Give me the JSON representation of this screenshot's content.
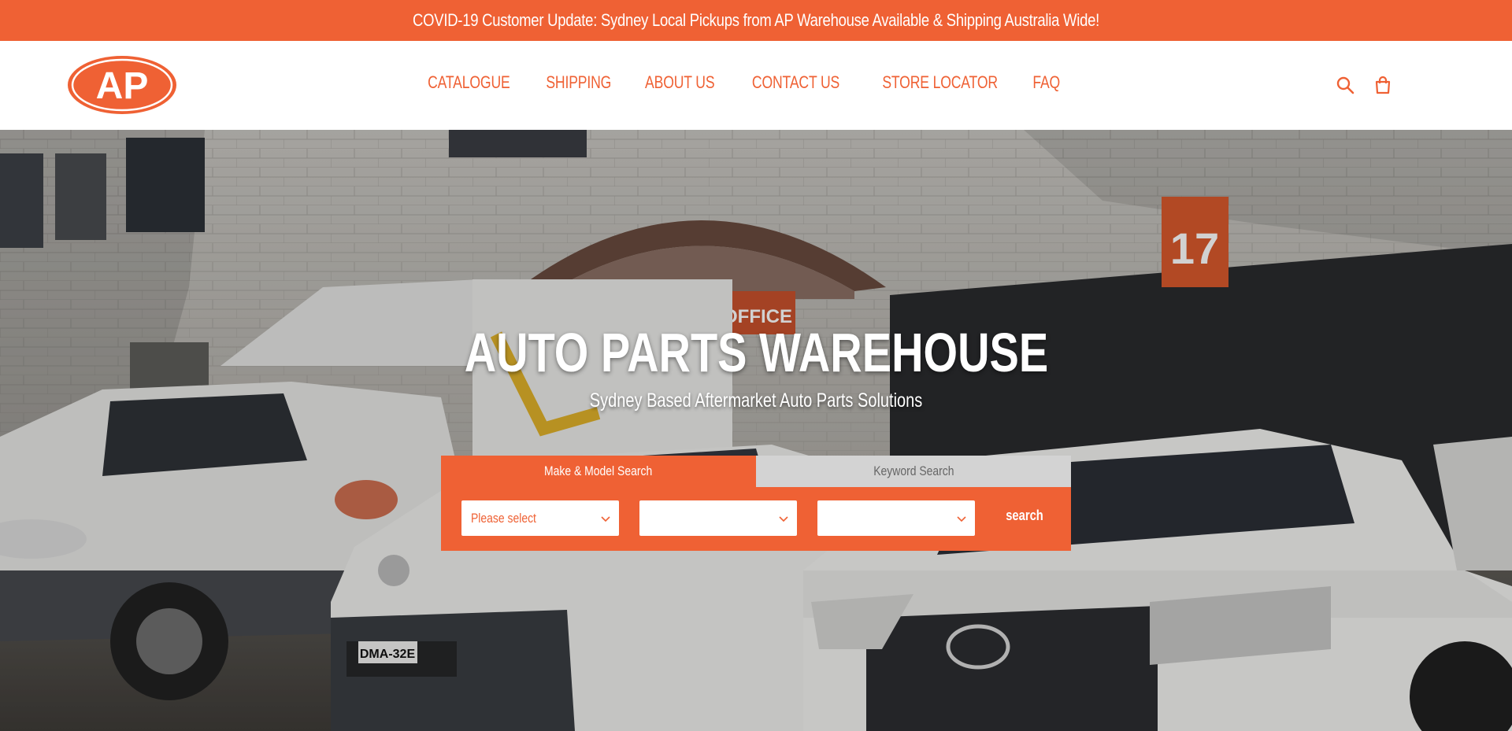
{
  "announcement": {
    "text": "COVID-19 Customer Update: Sydney Local Pickups from AP Warehouse Available & Shipping Australia Wide!"
  },
  "header": {
    "logo_text": "AP",
    "nav": [
      {
        "label": "CATALOGUE"
      },
      {
        "label": "SHIPPING"
      },
      {
        "label": "ABOUT US"
      },
      {
        "label": "CONTACT US"
      },
      {
        "label": "STORE LOCATOR"
      },
      {
        "label": "FAQ"
      }
    ],
    "icons": [
      "search-icon",
      "cart-icon"
    ]
  },
  "hero": {
    "title": "AUTO PARTS WAREHOUSE",
    "subtitle": "Sydney Based Aftermarket Auto Parts Solutions",
    "image_text": {
      "sign": "OFFICE",
      "unit_number": "17",
      "plate": "DMA-32E"
    }
  },
  "search": {
    "tabs": [
      {
        "label": "Make & Model Search",
        "active": true
      },
      {
        "label": "Keyword Search",
        "active": false
      }
    ],
    "selects": [
      {
        "value": "Please select"
      },
      {
        "value": ""
      },
      {
        "value": ""
      }
    ],
    "button_label": "search"
  },
  "colors": {
    "brand": "#ef6134",
    "inactive_tab": "#d3d3d3"
  }
}
